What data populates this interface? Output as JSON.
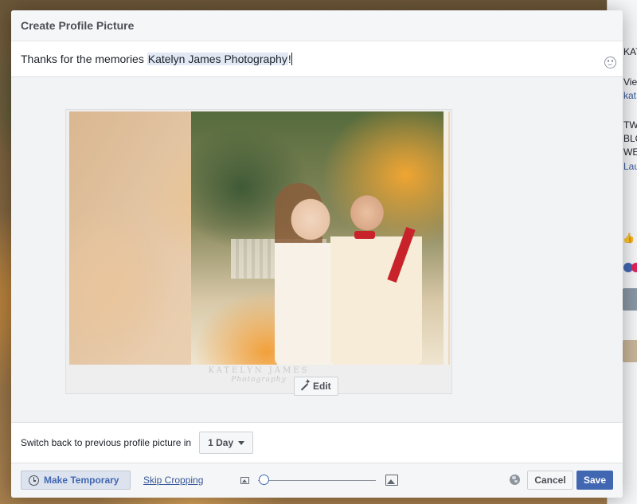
{
  "dialog": {
    "title": "Create Profile Picture"
  },
  "caption": {
    "prefix": "Thanks for the memories ",
    "tag": "Katelyn James Photography",
    "suffix": "!"
  },
  "photo": {
    "watermark_main": "KATELYN JAMES",
    "watermark_script": "Photography"
  },
  "edit": {
    "label": "Edit"
  },
  "temporary": {
    "label": "Switch back to previous profile picture in",
    "duration": "1 Day"
  },
  "footer": {
    "make_temporary": "Make Temporary",
    "skip_cropping": "Skip Cropping",
    "cancel": "Cancel",
    "save": "Save",
    "zoom_level": 0.05
  },
  "background_page": {
    "frag1": "KAT",
    "frag2": "Vie",
    "frag3": "kat",
    "frag4": "TW",
    "frag5": "BLO",
    "frag6": "WE",
    "frag7": "Lau"
  },
  "colors": {
    "brand_blue": "#4267b2",
    "link_blue": "#365899",
    "tag_highlight": "#e2e9f5"
  },
  "icons": [
    "emoji-icon",
    "magic-wand-icon",
    "chevron-down-icon",
    "clock-icon",
    "image-small-icon",
    "image-large-icon",
    "globe-icon"
  ]
}
